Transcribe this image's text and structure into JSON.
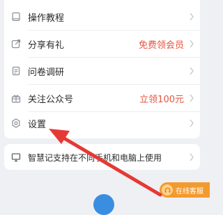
{
  "menu": {
    "items": [
      {
        "label": "操作教程",
        "extra": "",
        "icon": "device-icon"
      },
      {
        "label": "分享有礼",
        "extra": "免费领会员",
        "icon": "share-icon"
      },
      {
        "label": "问卷调研",
        "extra": "",
        "icon": "survey-icon"
      },
      {
        "label": "关注公众号",
        "extra": "立领100元",
        "icon": "gift-icon"
      },
      {
        "label": "设置",
        "extra": "",
        "icon": "gear-icon"
      }
    ]
  },
  "info": {
    "text": "智慧记支持在不同手机和电脑上使用",
    "icon": "monitor-icon"
  },
  "support": {
    "label": "在线客服",
    "icon": "headset-icon"
  },
  "colors": {
    "accent_red": "#e5533d",
    "annotation_red": "#e53935",
    "support_orange": "#f39a2f",
    "fab_blue": "#3a8ee0"
  }
}
